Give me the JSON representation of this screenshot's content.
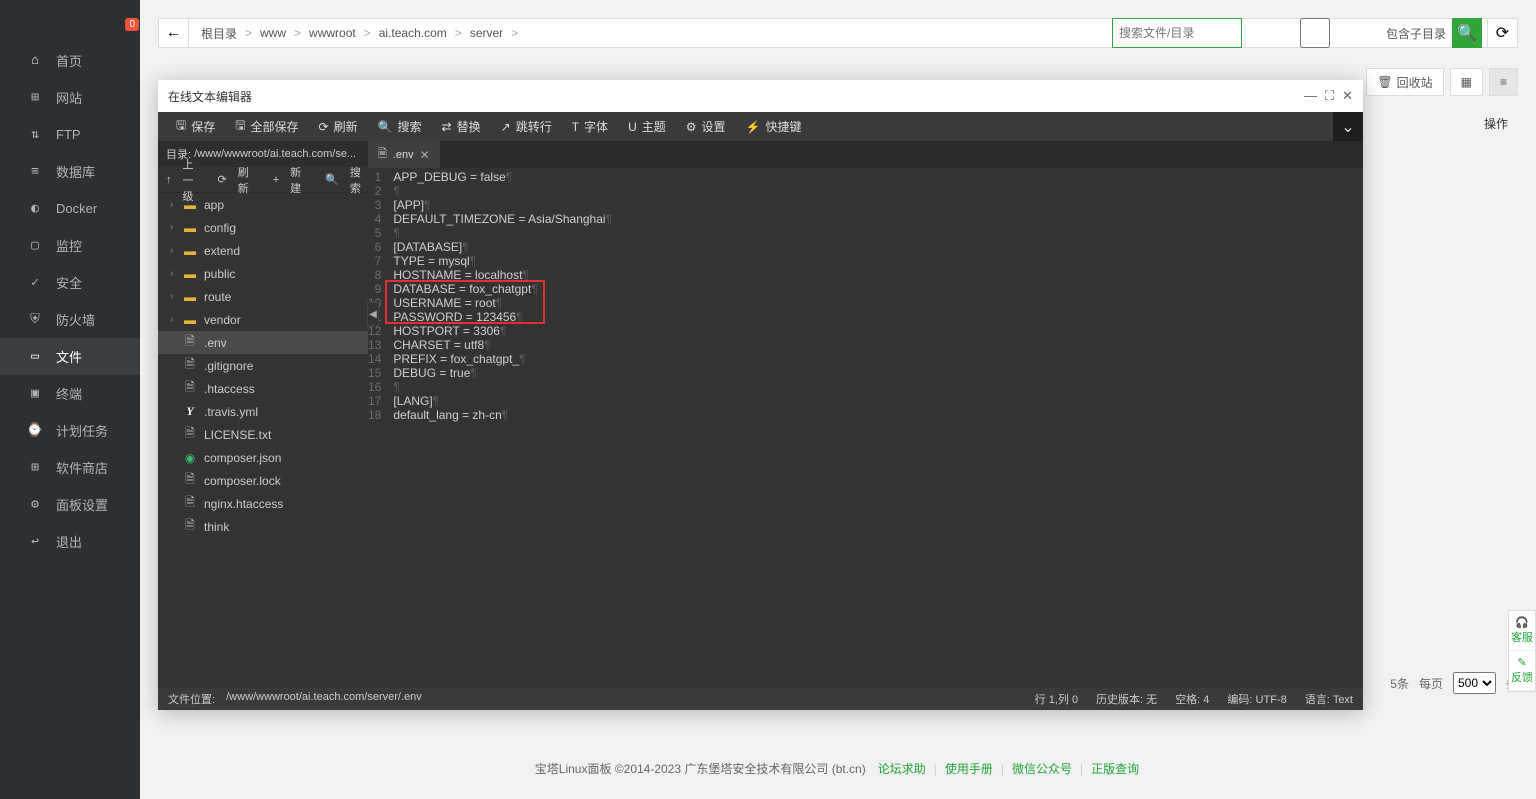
{
  "sidebar": {
    "badge": "0",
    "items": [
      {
        "icon": "⌂",
        "label": "首页"
      },
      {
        "icon": "⊞",
        "label": "网站"
      },
      {
        "icon": "⇅",
        "label": "FTP"
      },
      {
        "icon": "≡",
        "label": "数据库"
      },
      {
        "icon": "◐",
        "label": "Docker"
      },
      {
        "icon": "▢",
        "label": "监控"
      },
      {
        "icon": "✓",
        "label": "安全"
      },
      {
        "icon": "⛨",
        "label": "防火墙"
      },
      {
        "icon": "▭",
        "label": "文件",
        "active": true
      },
      {
        "icon": "▣",
        "label": "终端"
      },
      {
        "icon": "⌚",
        "label": "计划任务"
      },
      {
        "icon": "⊞",
        "label": "软件商店"
      },
      {
        "icon": "⚙",
        "label": "面板设置"
      },
      {
        "icon": "↩",
        "label": "退出"
      }
    ]
  },
  "breadcrumbs": [
    "根目录",
    "www",
    "wwwroot",
    "ai.teach.com",
    "server"
  ],
  "search": {
    "placeholder": "搜索文件/目录",
    "include_sub": "包含子目录"
  },
  "rightbtns": {
    "recycle": "回收站"
  },
  "ops_label": "操作",
  "pager": {
    "suffix": "5条",
    "per_page_prefix": "每页",
    "per_page": "500",
    "unit": "条"
  },
  "copyright": {
    "text": "宝塔Linux面板 ©2014-2023 广东堡塔安全技术有限公司 (bt.cn)",
    "links": [
      "论坛求助",
      "使用手册",
      "微信公众号",
      "正版查询"
    ]
  },
  "float": {
    "svc": "客服",
    "fb": "反馈"
  },
  "editor": {
    "title": "在线文本编辑器",
    "toolbar": [
      {
        "icon": "🖫",
        "label": "保存"
      },
      {
        "icon": "🖫",
        "label": "全部保存"
      },
      {
        "icon": "⟳",
        "label": "刷新"
      },
      {
        "icon": "🔍",
        "label": "搜索"
      },
      {
        "icon": "⇄",
        "label": "替换"
      },
      {
        "icon": "↗",
        "label": "跳转行"
      },
      {
        "icon": "T",
        "label": "字体"
      },
      {
        "icon": "U",
        "label": "主题"
      },
      {
        "icon": "⚙",
        "label": "设置"
      },
      {
        "icon": "⚡",
        "label": "快捷键"
      }
    ],
    "path_label": "目录:",
    "path": "/www/wwwroot/ai.teach.com/se...",
    "tree_ops": {
      "up": "上一级",
      "refresh": "刷新",
      "new": "新建",
      "search": "搜索"
    },
    "tree": [
      {
        "type": "folder",
        "name": "app",
        "chev": true
      },
      {
        "type": "folder",
        "name": "config",
        "chev": true
      },
      {
        "type": "folder",
        "name": "extend",
        "chev": true
      },
      {
        "type": "folder",
        "name": "public",
        "chev": true
      },
      {
        "type": "folder",
        "name": "route",
        "chev": true
      },
      {
        "type": "folder",
        "name": "vendor",
        "chev": true
      },
      {
        "type": "file",
        "name": ".env",
        "sel": true
      },
      {
        "type": "file",
        "name": ".gitignore"
      },
      {
        "type": "file",
        "name": ".htaccess"
      },
      {
        "type": "y",
        "name": ".travis.yml"
      },
      {
        "type": "file",
        "name": "LICENSE.txt"
      },
      {
        "type": "json",
        "name": "composer.json"
      },
      {
        "type": "file",
        "name": "composer.lock"
      },
      {
        "type": "file",
        "name": "nginx.htaccess"
      },
      {
        "type": "file",
        "name": "think"
      }
    ],
    "tab": {
      "name": ".env"
    },
    "code": [
      "APP_DEBUG = false",
      "",
      "[APP]",
      "DEFAULT_TIMEZONE = Asia/Shanghai",
      "",
      "[DATABASE]",
      "TYPE = mysql",
      "HOSTNAME = localhost",
      "DATABASE = fox_chatgpt",
      "USERNAME = root",
      "PASSWORD = 123456",
      "HOSTPORT = 3306",
      "CHARSET = utf8",
      "PREFIX = fox_chatgpt_",
      "DEBUG = true",
      "",
      "[LANG]",
      "default_lang = zh-cn"
    ],
    "highlight": {
      "from": 9,
      "to": 11
    },
    "status": {
      "filepos_label": "文件位置:",
      "filepos": "/www/wwwroot/ai.teach.com/server/.env",
      "rowcol": "行 1,列 0",
      "history": "历史版本:  无",
      "spaces": "空格:  4",
      "enc": "编码:  UTF-8",
      "lang": "语言:  Text"
    }
  }
}
